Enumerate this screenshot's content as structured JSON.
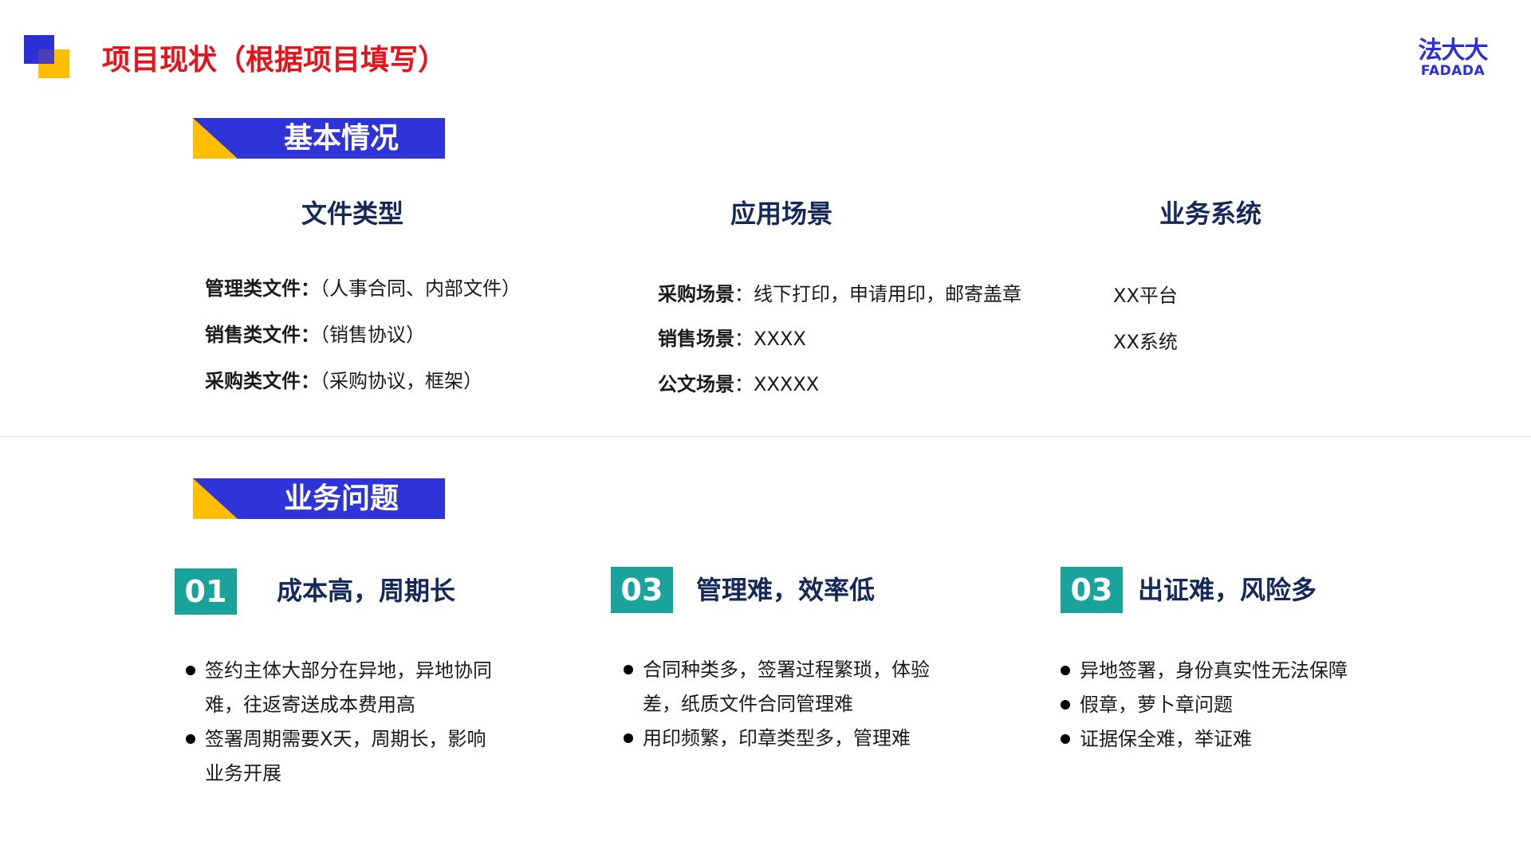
{
  "header": {
    "title": "项目现状（根据项目填写）",
    "brand_cn": "法大大",
    "brand_en": "FADADA",
    "colors": {
      "title": "#E8131A",
      "brand": "#2A2FD6",
      "accent_yellow": "#FFBF00",
      "teal": "#1AA39B",
      "heading": "#14285A"
    }
  },
  "basic": {
    "banner": "基本情况",
    "file_types": {
      "heading": "文件类型",
      "items": [
        {
          "label": "管理类文件：",
          "value": "（人事合同、内部文件）"
        },
        {
          "label": "销售类文件：",
          "value": "（销售协议）"
        },
        {
          "label": "采购类文件：",
          "value": "（采购协议，框架）"
        }
      ]
    },
    "scenarios": {
      "heading": "应用场景",
      "items": [
        {
          "label": "采购场景",
          "value": "：线下打印，申请用印，邮寄盖章"
        },
        {
          "label": "销售场景",
          "value": "：XXXX"
        },
        {
          "label": "公文场景",
          "value": "：XXXXX"
        }
      ]
    },
    "systems": {
      "heading": "业务系统",
      "items": [
        "XX平台",
        "XX系统"
      ]
    }
  },
  "problems": {
    "banner": "业务问题",
    "issues": [
      {
        "number": "01",
        "title": "成本高，周期长",
        "bullets": [
          "签约主体大部分在异地，异地协同难，往返寄送成本费用高",
          "签署周期需要X天，周期长，影响业务开展"
        ]
      },
      {
        "number": "03",
        "title": "管理难，效率低",
        "bullets": [
          "合同种类多，签署过程繁琐，体验差，纸质文件合同管理难",
          "用印频繁，印章类型多，管理难"
        ]
      },
      {
        "number": "03",
        "title": "出证难，风险多",
        "bullets": [
          "异地签署，身份真实性无法保障",
          "假章，萝卜章问题",
          "证据保全难，举证难"
        ]
      }
    ]
  }
}
